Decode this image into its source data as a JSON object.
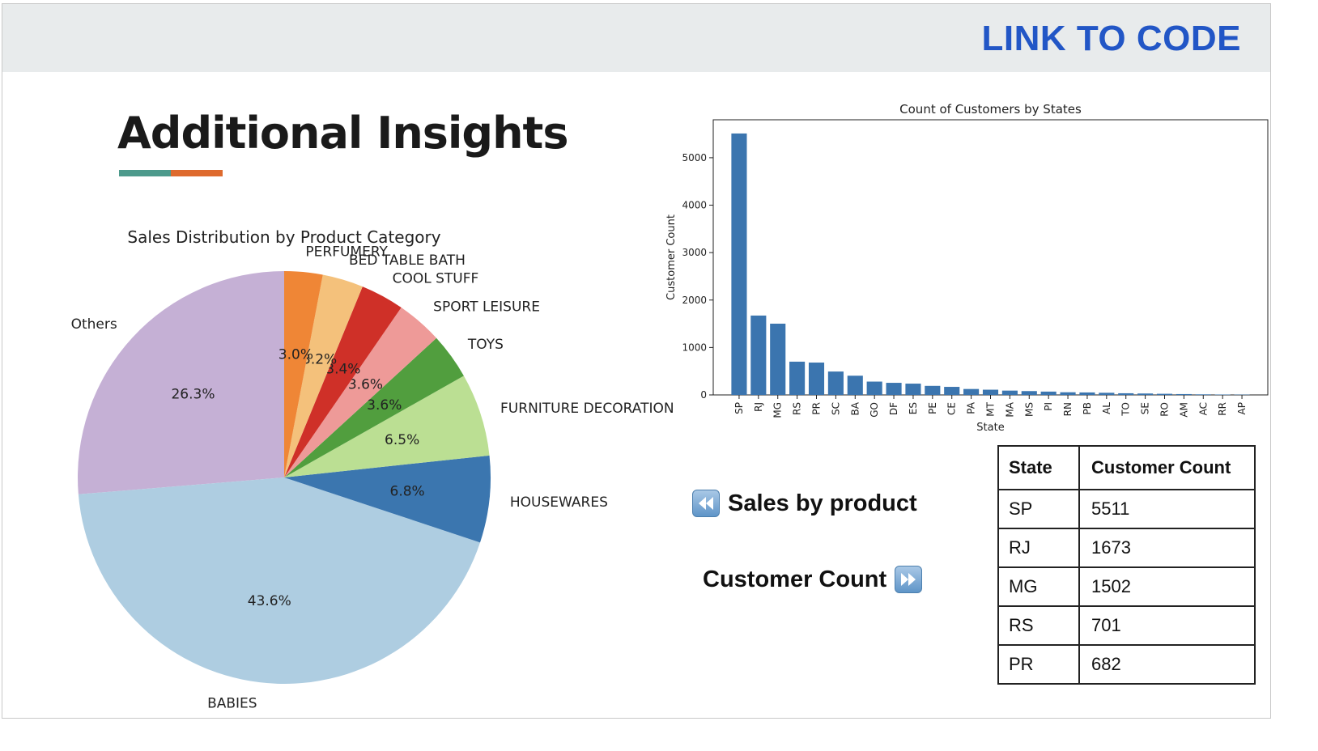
{
  "header": {
    "link_label": "LINK TO CODE"
  },
  "page": {
    "title": "Additional Insights",
    "accent_colors": [
      "#4d9a8c",
      "#de6a2e"
    ]
  },
  "nav": {
    "prev_label": "Sales by product",
    "prev_icon": "rewind-icon",
    "next_label": "Customer Count",
    "next_icon": "fast-forward-icon"
  },
  "table": {
    "headers": [
      "State",
      "Customer Count"
    ],
    "rows": [
      [
        "SP",
        "5511"
      ],
      [
        "RJ",
        "1673"
      ],
      [
        "MG",
        "1502"
      ],
      [
        "RS",
        "701"
      ],
      [
        "PR",
        "682"
      ]
    ]
  },
  "chart_data": [
    {
      "type": "pie",
      "title": "Sales Distribution by Product Category",
      "start_angle_deg": 90,
      "direction": "counterclockwise",
      "slices": [
        {
          "label": "Others",
          "value": 26.3,
          "pct_label": "26.3%",
          "color": "#c5b0d5"
        },
        {
          "label": "BABIES",
          "value": 43.6,
          "pct_label": "43.6%",
          "color": "#aecde1"
        },
        {
          "label": "HOUSEWARES",
          "value": 6.8,
          "pct_label": "6.8%",
          "color": "#3b76af"
        },
        {
          "label": "FURNITURE DECORATION",
          "value": 6.5,
          "pct_label": "6.5%",
          "color": "#bbdf93"
        },
        {
          "label": "TOYS",
          "value": 3.6,
          "pct_label": "3.6%",
          "color": "#519e3e"
        },
        {
          "label": "SPORT LEISURE",
          "value": 3.6,
          "pct_label": "3.6%",
          "color": "#ee9a98"
        },
        {
          "label": "COOL STUFF",
          "value": 3.4,
          "pct_label": "3.4%",
          "color": "#cf3028"
        },
        {
          "label": "BED TABLE BATH",
          "value": 3.2,
          "pct_label": "3.2%",
          "color": "#f4c17b"
        },
        {
          "label": "PERFUMERY",
          "value": 3.0,
          "pct_label": "3.0%",
          "color": "#ef8636"
        }
      ]
    },
    {
      "type": "bar",
      "title": "Count of Customers by States",
      "xlabel": "State",
      "ylabel": "Customer Count",
      "bar_color": "#3b75af",
      "ylim": [
        0,
        5800
      ],
      "yticks": [
        0,
        1000,
        2000,
        3000,
        4000,
        5000
      ],
      "categories": [
        "SP",
        "RJ",
        "MG",
        "RS",
        "PR",
        "SC",
        "BA",
        "GO",
        "DF",
        "ES",
        "PE",
        "CE",
        "PA",
        "MT",
        "MA",
        "MS",
        "PI",
        "RN",
        "PB",
        "AL",
        "TO",
        "SE",
        "RO",
        "AM",
        "AC",
        "RR",
        "AP"
      ],
      "values": [
        5511,
        1673,
        1502,
        701,
        682,
        493,
        405,
        281,
        255,
        238,
        191,
        170,
        125,
        110,
        91,
        81,
        70,
        56,
        52,
        45,
        35,
        30,
        24,
        18,
        12,
        8,
        6
      ]
    }
  ]
}
